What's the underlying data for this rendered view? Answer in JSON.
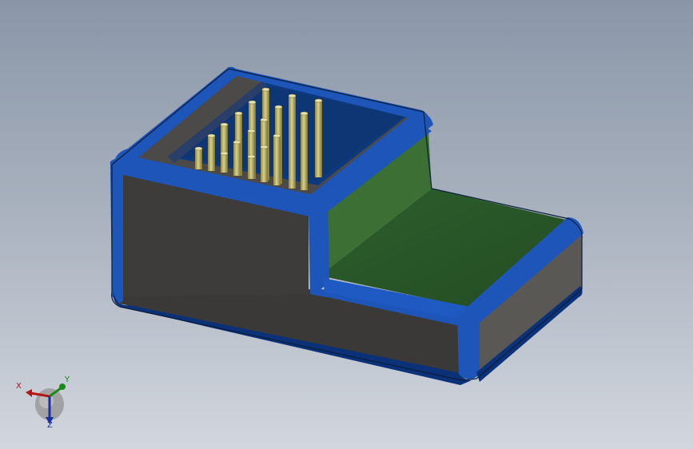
{
  "scene": {
    "background_top": "#8a96a8",
    "background_bottom": "#d2d6de",
    "colors": {
      "fillet_blue": "#1d55b8",
      "fillet_dark": "#0b3178",
      "body_gray": "#3d3c3b",
      "body_gray_light": "#5a5855",
      "pcb_green": "#2a5a2a",
      "pcb_green_light": "#3f7a35",
      "pin_gold": "#c8c07a"
    }
  },
  "triad": {
    "x_label": "X",
    "y_label": "Y",
    "z_label": "Z",
    "x_color": "#b01818",
    "y_color": "#1a8a1a",
    "z_color": "#1a2fa0"
  }
}
